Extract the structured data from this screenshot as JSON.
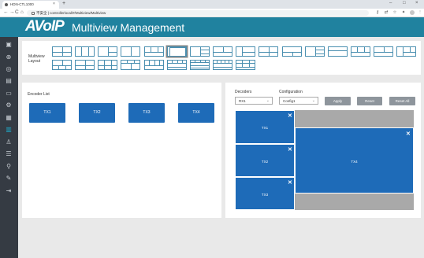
{
  "browser": {
    "tab_title": "HDN-CTL1000",
    "new_tab": "+",
    "tab_close": "×",
    "address": "不安全 | controllerlocal/#/Multiview/Multiview",
    "nav_back": "←",
    "nav_forward": "→",
    "nav_reload": "C",
    "nav_home": "⌂",
    "win_min": "–",
    "win_max": "□",
    "win_close": "×"
  },
  "app": {
    "logo": "AVoIP",
    "title": "Multiview Management"
  },
  "layout_panel": {
    "label": "Multiview Layout",
    "selected_index": 5,
    "count": 25
  },
  "encoders": {
    "title": "Encoder List",
    "items": [
      "TX1",
      "TX2",
      "TX3",
      "TX4"
    ]
  },
  "decoders": {
    "decoders_label": "Decoders",
    "decoder_value": "RX1",
    "configuration_label": "Configuration",
    "configuration_value": "Config1",
    "apply_label": "Apply",
    "reset_label": "Reset",
    "reset_all_label": "Reset All",
    "windows": [
      {
        "label": "TX1"
      },
      {
        "label": "TX2"
      },
      {
        "label": "TX3"
      },
      {
        "label": "TX4"
      }
    ],
    "close_glyph": "✕"
  },
  "colors": {
    "header": "#20829f",
    "sidebar": "#353b43",
    "tx_button": "#1e6bb8",
    "action_button": "#8e959c",
    "canvas_bg": "#a9a9a9"
  }
}
